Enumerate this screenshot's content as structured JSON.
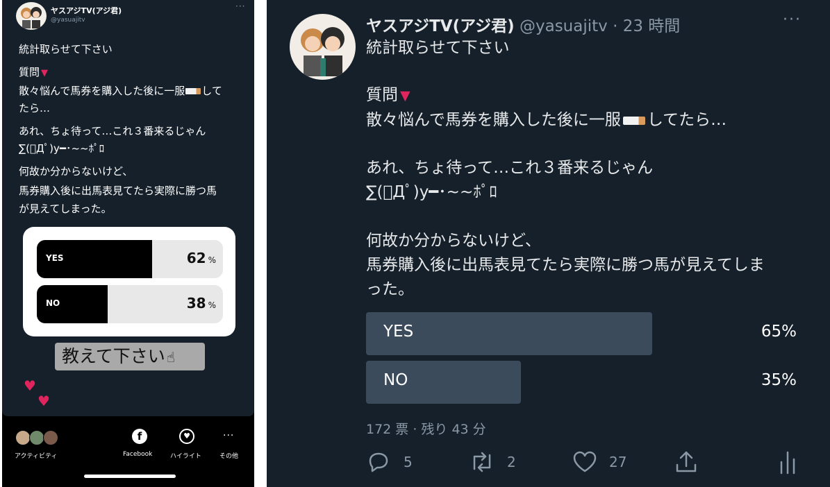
{
  "left_post": {
    "name": "ヤスアジTV(アジ君)",
    "handle": "@yasuajitv",
    "more": "···",
    "line1": "統計取らせて下さい",
    "question_label": "質問",
    "line2a": "散々悩んで馬券を購入した後に一服",
    "line2b": "して",
    "line2c": "たら…",
    "line3a": "あれ、ちょ待って…これ３番来るじゃん",
    "line3b": "∑(ﾟДﾟ)y━･~~ﾎﾟﾛ",
    "line4a": "何故か分からないけど、",
    "line4b": "馬券購入後に出馬表見てたら実際に勝つ馬",
    "line4c": "が見えてしまった。"
  },
  "left_poll": {
    "options": [
      {
        "label": "YES",
        "percent_value": "62",
        "percent_sign": "%",
        "fill": 0.62
      },
      {
        "label": "NO",
        "percent_value": "38",
        "percent_sign": "%",
        "fill": 0.38
      }
    ]
  },
  "left_sticker": "教えて下さい",
  "left_bottom": {
    "activity": "アクティビティ",
    "facebook": "Facebook",
    "highlight": "ハイライト",
    "other": "その他"
  },
  "tweet": {
    "name": "ヤスアジTV(アジ君)",
    "meta": " @yasuajitv · 23 時間",
    "more": "···",
    "line1": "統計取らせて下さい",
    "question_label": "質問",
    "line2a": "散々悩んで馬券を購入した後に一服",
    "line2b": "してたら…",
    "line3a": "あれ、ちょ待って…これ３番来るじゃん",
    "line3b": "∑(ﾟДﾟ)y━･~~ﾎﾟﾛ",
    "line4a": "何故か分からないけど、",
    "line4b": "馬券購入後に出馬表見てたら実際に勝つ馬が見えてしま",
    "line4c": "った。",
    "poll": [
      {
        "label": "YES",
        "percent": "65%",
        "fill": 0.665
      },
      {
        "label": "NO",
        "percent": "35%",
        "fill": 0.36
      }
    ],
    "votes": "172 票 · 残り 43 分",
    "actions": {
      "replies": "5",
      "retweets": "2",
      "likes": "27"
    }
  },
  "colors": {
    "background": "#15202b",
    "poll_bar": "#3b4b5c",
    "muted_text": "#8b98a5",
    "heart": "#e0245e",
    "triangle": "#e0245e"
  }
}
